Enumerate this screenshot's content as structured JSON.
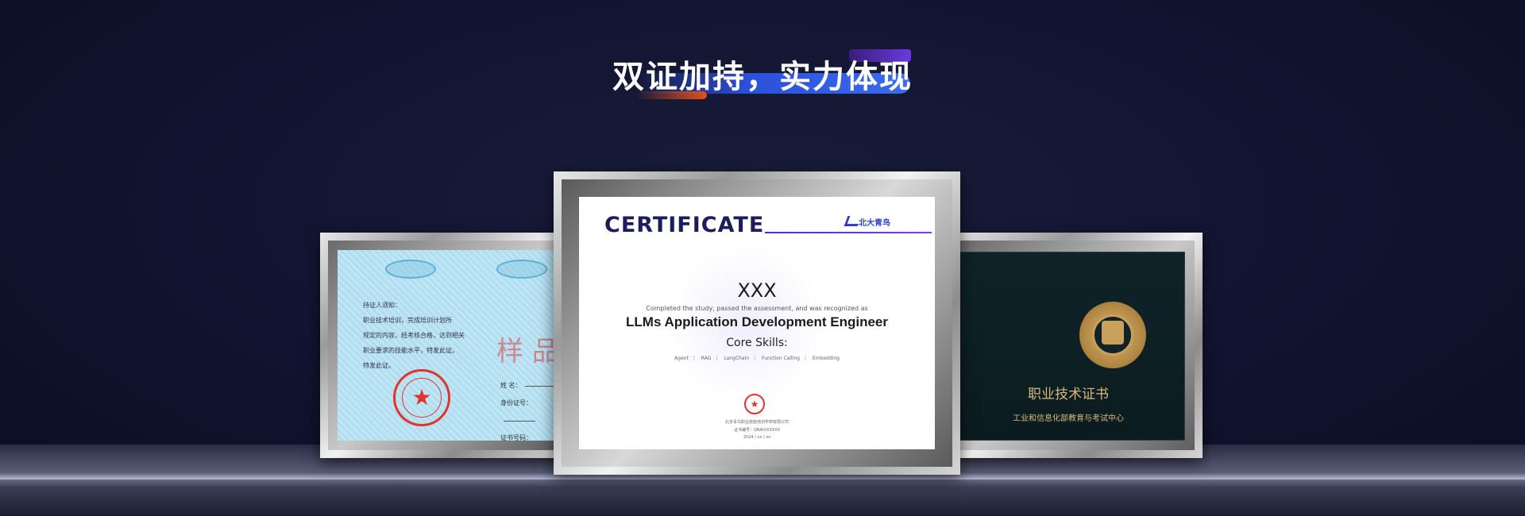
{
  "header": {
    "title": "双证加持，实力体现"
  },
  "certificates": {
    "left": {
      "intro_lines": [
        "持证人须知：",
        "职业技术培训，完成培训计划所",
        "规定的内容，经考核合格，达到相关",
        "职业要求的技能水平，特发此证。",
        "特发此证。"
      ],
      "watermark": "样 品",
      "fields": [
        "姓    名：",
        "身份证号：",
        "证书号码："
      ]
    },
    "center": {
      "heading": "CERTIFICATE",
      "brand": "北大青鸟",
      "name": "XXX",
      "description": "Completed the study, passed the assessment, and was recognized as",
      "role": "LLMs Application Development Engineer",
      "skills_heading": "Core Skills:",
      "skills": [
        "Agent",
        "RAG",
        "LangChain",
        "Function Calling",
        "Embedding"
      ],
      "issuer": "北京青鸟职业技能培训学校有限公司",
      "cert_number": "证书编号：QNAIXXXXXX",
      "date": "2024 / xx / xx"
    },
    "right": {
      "title": "职业技术证书",
      "issuer": "工业和信息化部教育与考试中心"
    }
  },
  "colors": {
    "background": "#111430",
    "accent_blue": "#2b4fd8",
    "accent_orange": "#e0501c",
    "cert_navy": "#1c1d5a",
    "seal_red": "#e0342c",
    "gold": "#d9b77a"
  }
}
